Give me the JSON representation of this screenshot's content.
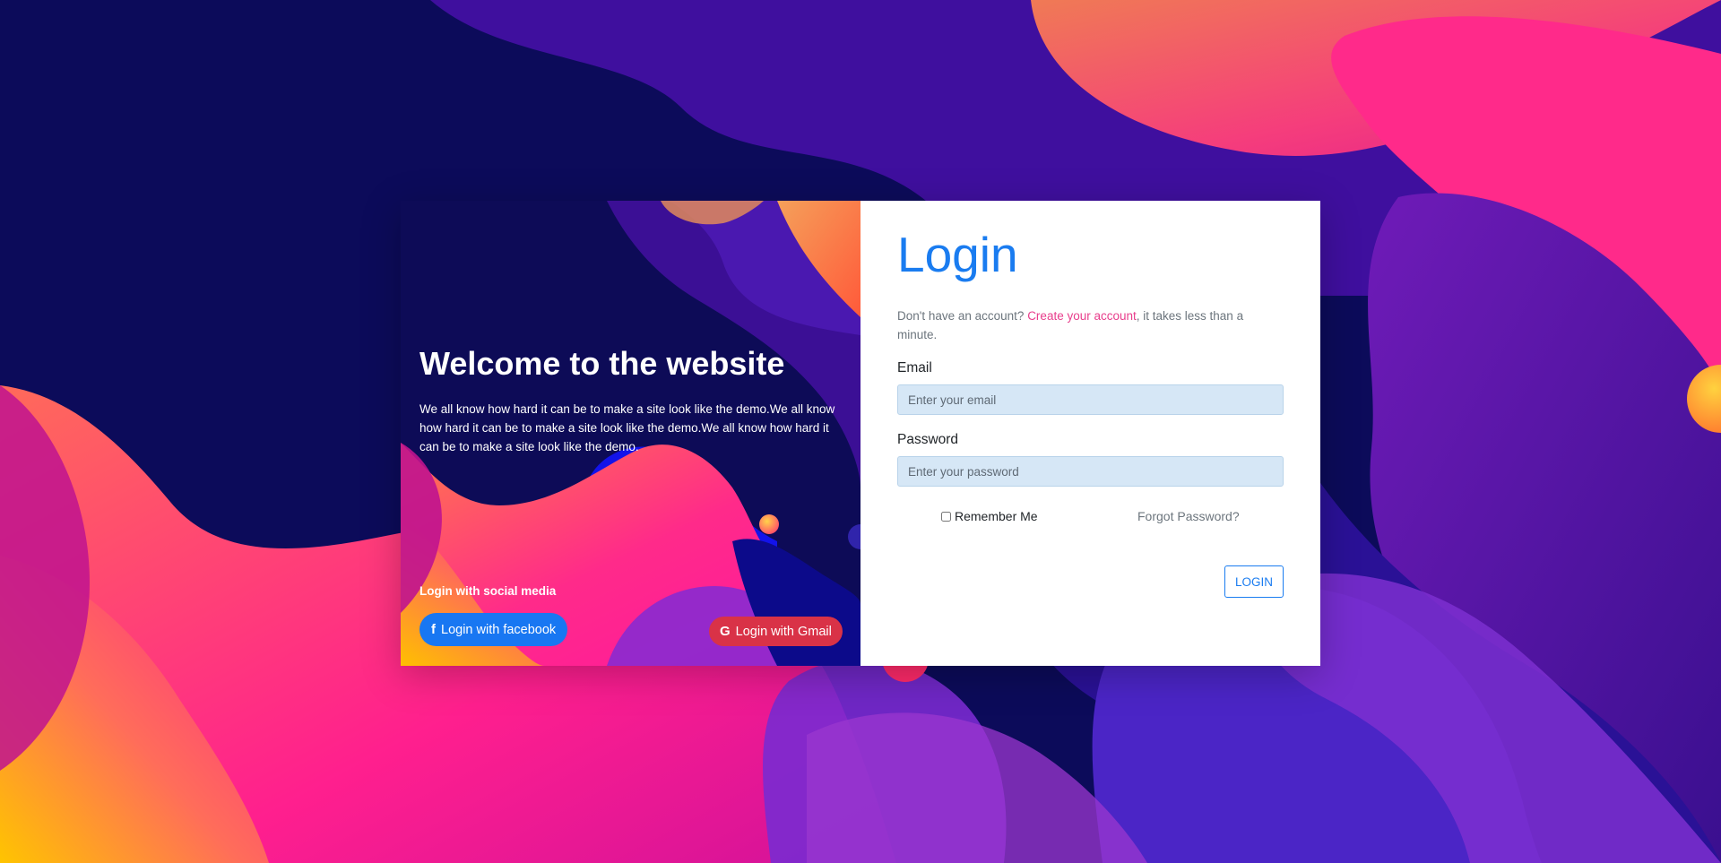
{
  "colors": {
    "accent": "#1a7cf0",
    "link": "#e83e8c",
    "facebook": "#1877f2",
    "gmail": "#d93247",
    "background": "#0b0a5e"
  },
  "left": {
    "title": "Welcome to the website",
    "description": "We all know how hard it can be to make a site look like the demo.We all know how hard it can be to make a site look like the demo.We all know how hard it can be to make a site look like the demo.",
    "social_label": "Login with social media",
    "facebook_icon": "f",
    "facebook_icon_name": "facebook-icon",
    "facebook_label": "Login with facebook",
    "gmail_icon": "G",
    "gmail_icon_name": "google-icon",
    "gmail_label": "Login with Gmail"
  },
  "form": {
    "title": "Login",
    "prompt_before": "Don't have an account? ",
    "create_link": "Create your account",
    "prompt_after": ", it takes less than a minute.",
    "email_label": "Email",
    "email_placeholder": "Enter your email",
    "email_value": "",
    "password_label": "Password",
    "password_placeholder": "Enter your password",
    "password_value": "",
    "remember_label": "Remember Me",
    "remember_checked": false,
    "forgot_label": "Forgot Password?",
    "submit_label": "LOGIN"
  }
}
